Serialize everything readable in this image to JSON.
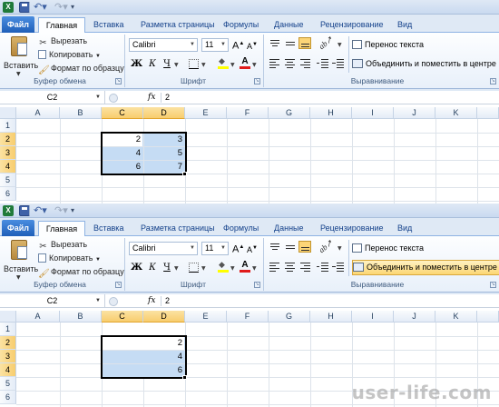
{
  "screens": [
    {
      "tabs": [
        "Файл",
        "Главная",
        "Вставка",
        "Разметка страницы",
        "Формулы",
        "Данные",
        "Рецензирование",
        "Вид"
      ],
      "clipboard": {
        "paste_label": "Вставить",
        "cut_label": "Вырезать",
        "copy_label": "Копировать",
        "format_painter_label": "Формат по образцу",
        "group_label": "Буфер обмена"
      },
      "font": {
        "name": "Calibri",
        "size": "11",
        "grow_label": "A",
        "shrink_label": "A",
        "bold": "Ж",
        "italic": "К",
        "underline": "Ч",
        "color_letter": "A",
        "group_label": "Шрифт"
      },
      "alignment": {
        "wrap_label": "Перенос текста",
        "merge_label": "Объединить и поместить в центре",
        "group_label": "Выравнивание"
      },
      "formula_bar": {
        "name_box": "C2",
        "fx": "fx",
        "value": "2"
      },
      "columns": [
        "A",
        "B",
        "C",
        "D",
        "E",
        "F",
        "G",
        "H",
        "I",
        "J",
        "K"
      ],
      "rows": [
        "1",
        "2",
        "3",
        "4",
        "5",
        "6"
      ],
      "cells": {
        "C2": "2",
        "D2": "3",
        "C3": "4",
        "D3": "5",
        "C4": "6",
        "D4": "7"
      },
      "merge_highlighted": false
    },
    {
      "tabs": [
        "Файл",
        "Главная",
        "Вставка",
        "Разметка страницы",
        "Формулы",
        "Данные",
        "Рецензирование",
        "Вид"
      ],
      "clipboard": {
        "paste_label": "Вставить",
        "cut_label": "Вырезать",
        "copy_label": "Копировать",
        "format_painter_label": "Формат по образцу",
        "group_label": "Буфер обмена"
      },
      "font": {
        "name": "Calibri",
        "size": "11",
        "grow_label": "A",
        "shrink_label": "A",
        "bold": "Ж",
        "italic": "К",
        "underline": "Ч",
        "color_letter": "A",
        "group_label": "Шрифт"
      },
      "alignment": {
        "wrap_label": "Перенос текста",
        "merge_label": "Объединить и поместить в центре",
        "group_label": "Выравнивание"
      },
      "formula_bar": {
        "name_box": "C2",
        "fx": "fx",
        "value": "2"
      },
      "columns": [
        "A",
        "B",
        "C",
        "D",
        "E",
        "F",
        "G",
        "H",
        "I",
        "J",
        "K"
      ],
      "rows": [
        "1",
        "2",
        "3",
        "4",
        "5",
        "6"
      ],
      "cells": {
        "D2": "2",
        "D3": "4",
        "D4": "6"
      },
      "merge_highlighted": true
    }
  ],
  "colors": {
    "file_tab": "#2a6cc8",
    "selection_fill": "#c5dcf4",
    "header_highlight": "#f8cd6e",
    "merge_highlight": "#fcd673",
    "fill_color_bar": "#ffff00",
    "font_color_bar": "#e01b1b"
  },
  "watermark": "user-life.com"
}
